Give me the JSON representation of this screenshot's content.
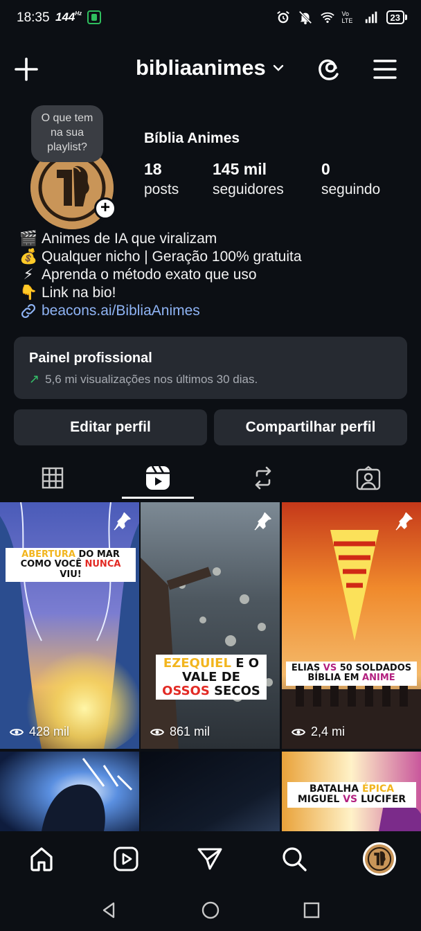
{
  "status_bar": {
    "time": "18:35",
    "refresh_rate": "144",
    "refresh_unit": "Hz",
    "network_label": "Vo LTE",
    "battery": "23"
  },
  "header": {
    "username": "bibliaanimes"
  },
  "profile": {
    "note": "O que tem na sua playlist?",
    "display_name": "Bíblia Animes",
    "stats": [
      {
        "value": "18",
        "label": "posts"
      },
      {
        "value": "145 mil",
        "label": "seguidores"
      },
      {
        "value": "0",
        "label": "seguindo"
      }
    ],
    "bio": [
      {
        "emoji": "🎬",
        "text": "Animes de IA que viralizam"
      },
      {
        "emoji": "💰",
        "text": "Qualquer nicho | Geração 100% gratuita"
      },
      {
        "emoji": "⚡",
        "text": "Aprenda o método exato que uso"
      },
      {
        "emoji": "👇",
        "text": "Link na bio!"
      }
    ],
    "link": "beacons.ai/BibliaAnimes"
  },
  "pro_panel": {
    "title": "Painel profissional",
    "subtitle": "5,6 mi visualizações nos últimos 30 dias."
  },
  "buttons": {
    "edit": "Editar perfil",
    "share": "Compartilhar perfil"
  },
  "tabs": [
    {
      "name": "grid-icon",
      "active": false
    },
    {
      "name": "reels-icon",
      "active": true
    },
    {
      "name": "reposts-icon",
      "active": false
    },
    {
      "name": "tagged-icon",
      "active": false
    }
  ],
  "grid": {
    "items": [
      {
        "caption_1a": "ABERTURA",
        "caption_1b": " DO MAR",
        "caption_2a": "COMO VOCÊ ",
        "caption_2b": "NUNCA",
        "caption_2c": " VIU!",
        "views": "428 mil",
        "pinned": true
      },
      {
        "caption_1a": "EZEQUIEL",
        "caption_1b": " E O",
        "caption_2a": "VALE DE",
        "caption_3a": "OSSOS",
        "caption_3b": " SECOS",
        "views": "861 mil",
        "pinned": true
      },
      {
        "caption_1a": "ELIAS ",
        "caption_1b": "VS",
        "caption_1c": " 50 SOLDADOS",
        "caption_2a": "BÍBLIA EM ",
        "caption_2b": "ANIME",
        "views": "2,4 mi",
        "pinned": true
      },
      {
        "views": ""
      },
      {
        "views": ""
      },
      {
        "caption_1a": "BATALHA ",
        "caption_1b": "ÉPICA",
        "caption_2a": "MIGUEL ",
        "caption_2b": "VS",
        "caption_2c": " LUCIFER",
        "views": ""
      }
    ]
  },
  "colors": {
    "background": "#0c0f14",
    "card": "#262a31",
    "link": "#8fb4f5",
    "trend_up": "#35c26a"
  }
}
